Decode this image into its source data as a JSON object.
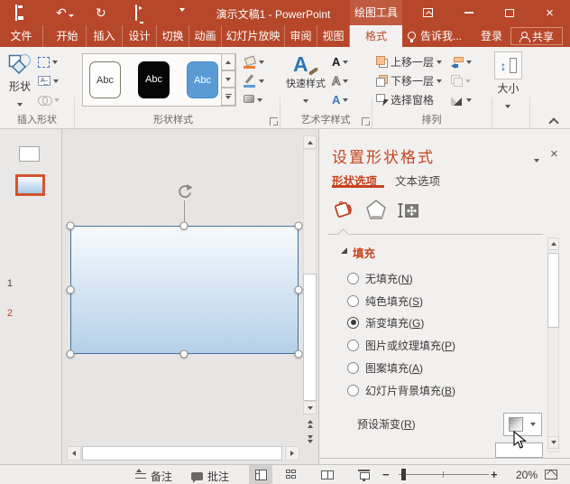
{
  "icons": {
    "undo": "↶",
    "redo": "↻",
    "window_close": "×",
    "pane_close": "×",
    "letter_a": "A",
    "updown_arrow": "↕",
    "zoom_out": "−",
    "zoom_in": "+"
  },
  "titlebar": {
    "title": "演示文稿1 - PowerPoint",
    "context_tools": "绘图工具"
  },
  "menubar": {
    "file": "文件",
    "tabs": [
      "开始",
      "插入",
      "设计",
      "切换",
      "动画",
      "幻灯片放映",
      "审阅",
      "视图"
    ],
    "active_tab": "格式",
    "tellme": "告诉我...",
    "signin": "登录",
    "share": "共享"
  },
  "ribbon": {
    "insert_shapes": {
      "group_label": "插入形状",
      "shapes_button": "形状"
    },
    "shape_styles": {
      "group_label": "形状样式",
      "chips": [
        "Abc",
        "Abc",
        "Abc"
      ]
    },
    "wordart": {
      "group_label": "艺术字样式",
      "quick_styles": "快速样式"
    },
    "arrange": {
      "group_label": "排列",
      "bring_forward": "上移一层",
      "send_backward": "下移一层",
      "selection_pane": "选择窗格"
    },
    "size": {
      "button_label": "大小"
    }
  },
  "slide_panel": {
    "slides": [
      {
        "num": "1",
        "selected": false
      },
      {
        "num": "2",
        "selected": true
      }
    ]
  },
  "format_panel": {
    "title": "设置形状格式",
    "tab_shape": "形状选项",
    "tab_text": "文本选项",
    "fill": {
      "header": "填充",
      "options": [
        {
          "t": "无填充(",
          "k": "N",
          "c": ")",
          "selected": false
        },
        {
          "t": "纯色填充(",
          "k": "S",
          "c": ")",
          "selected": false
        },
        {
          "t": "渐变填充(",
          "k": "G",
          "c": ")",
          "selected": true
        },
        {
          "t": "图片或纹理填充(",
          "k": "P",
          "c": ")",
          "selected": false
        },
        {
          "t": "图案填充(",
          "k": "A",
          "c": ")",
          "selected": false
        },
        {
          "t": "幻灯片背景填充(",
          "k": "B",
          "c": ")",
          "selected": false
        }
      ],
      "preset": {
        "t": "预设渐变(",
        "k": "R",
        "c": ")"
      }
    }
  },
  "statusbar": {
    "notes": "备注",
    "comments": "批注",
    "zoom_level": "20%"
  },
  "colors": {
    "titlebar_red": "#B7472A",
    "accent_red": "#C5431F",
    "selection_orange": "#D3552F",
    "style_blue": "#5B9BD5",
    "shape_border_blue": "#41719C",
    "gradient_top": "#F6FAFD",
    "gradient_bottom": "#B5D0EA"
  }
}
